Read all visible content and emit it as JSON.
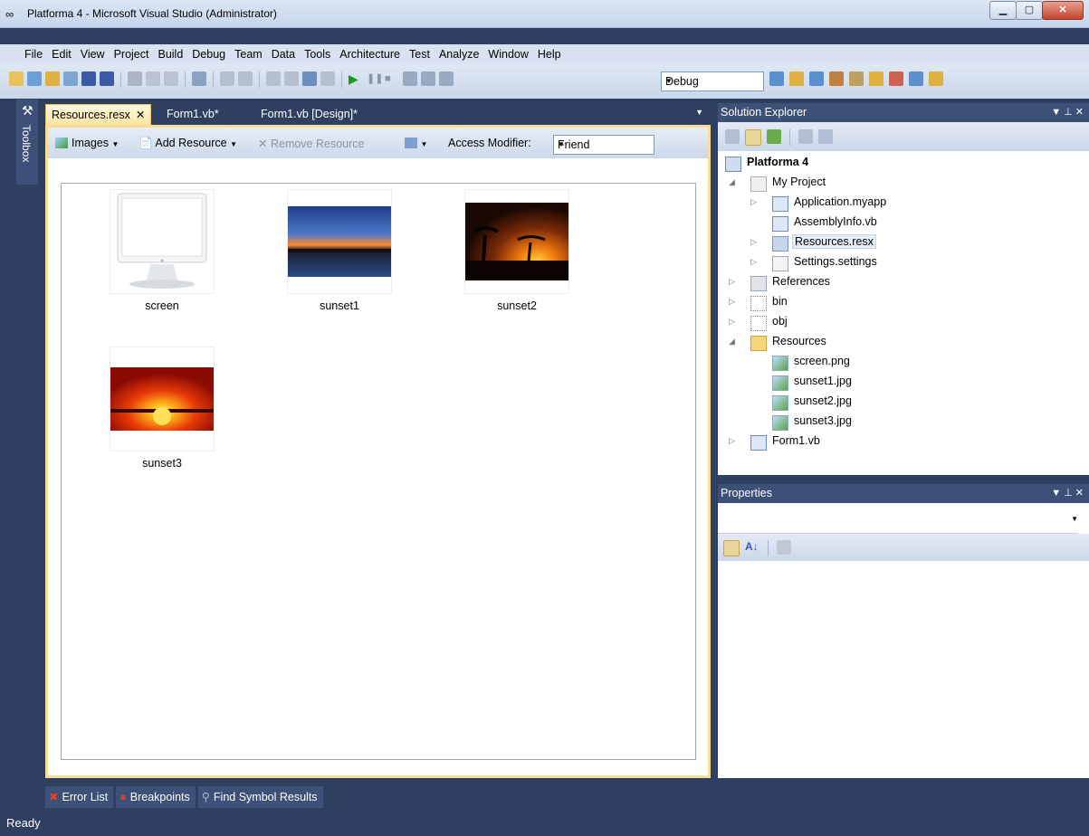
{
  "window": {
    "title": "Platforma 4 - Microsoft Visual Studio (Administrator)"
  },
  "menu": [
    "File",
    "Edit",
    "View",
    "Project",
    "Build",
    "Debug",
    "Team",
    "Data",
    "Tools",
    "Architecture",
    "Test",
    "Analyze",
    "Window",
    "Help"
  ],
  "toolbar": {
    "configuration": "Debug"
  },
  "toolbox": {
    "label": "Toolbox"
  },
  "doc_tabs": [
    {
      "label": "Resources.resx"
    },
    {
      "label": "Form1.vb*"
    },
    {
      "label": "Form1.vb [Design]*"
    }
  ],
  "resource_toolbar": {
    "images_label": "Images",
    "add_label": "Add Resource",
    "remove_label": "Remove Resource",
    "access_label": "Access Modifier:",
    "access_value": "Friend"
  },
  "resources": [
    {
      "name": "screen"
    },
    {
      "name": "sunset1"
    },
    {
      "name": "sunset2"
    },
    {
      "name": "sunset3"
    }
  ],
  "bottom_tabs": [
    "Error List",
    "Breakpoints",
    "Find Symbol Results"
  ],
  "status": "Ready",
  "solution_explorer": {
    "title": "Solution Explorer",
    "project": "Platforma 4",
    "nodes": {
      "my_project": "My Project",
      "application": "Application.myapp",
      "assembly": "AssemblyInfo.vb",
      "resources_resx": "Resources.resx",
      "settings": "Settings.settings",
      "references": "References",
      "bin": "bin",
      "obj": "obj",
      "resources_folder": "Resources",
      "screen_png": "screen.png",
      "sunset1_jpg": "sunset1.jpg",
      "sunset2_jpg": "sunset2.jpg",
      "sunset3_jpg": "sunset3.jpg",
      "form1": "Form1.vb"
    }
  },
  "properties": {
    "title": "Properties"
  },
  "colors": {
    "chrome_dark": "#2e3f60",
    "tab_active": "#fbe4a2",
    "pane_header": "#3d5178"
  }
}
